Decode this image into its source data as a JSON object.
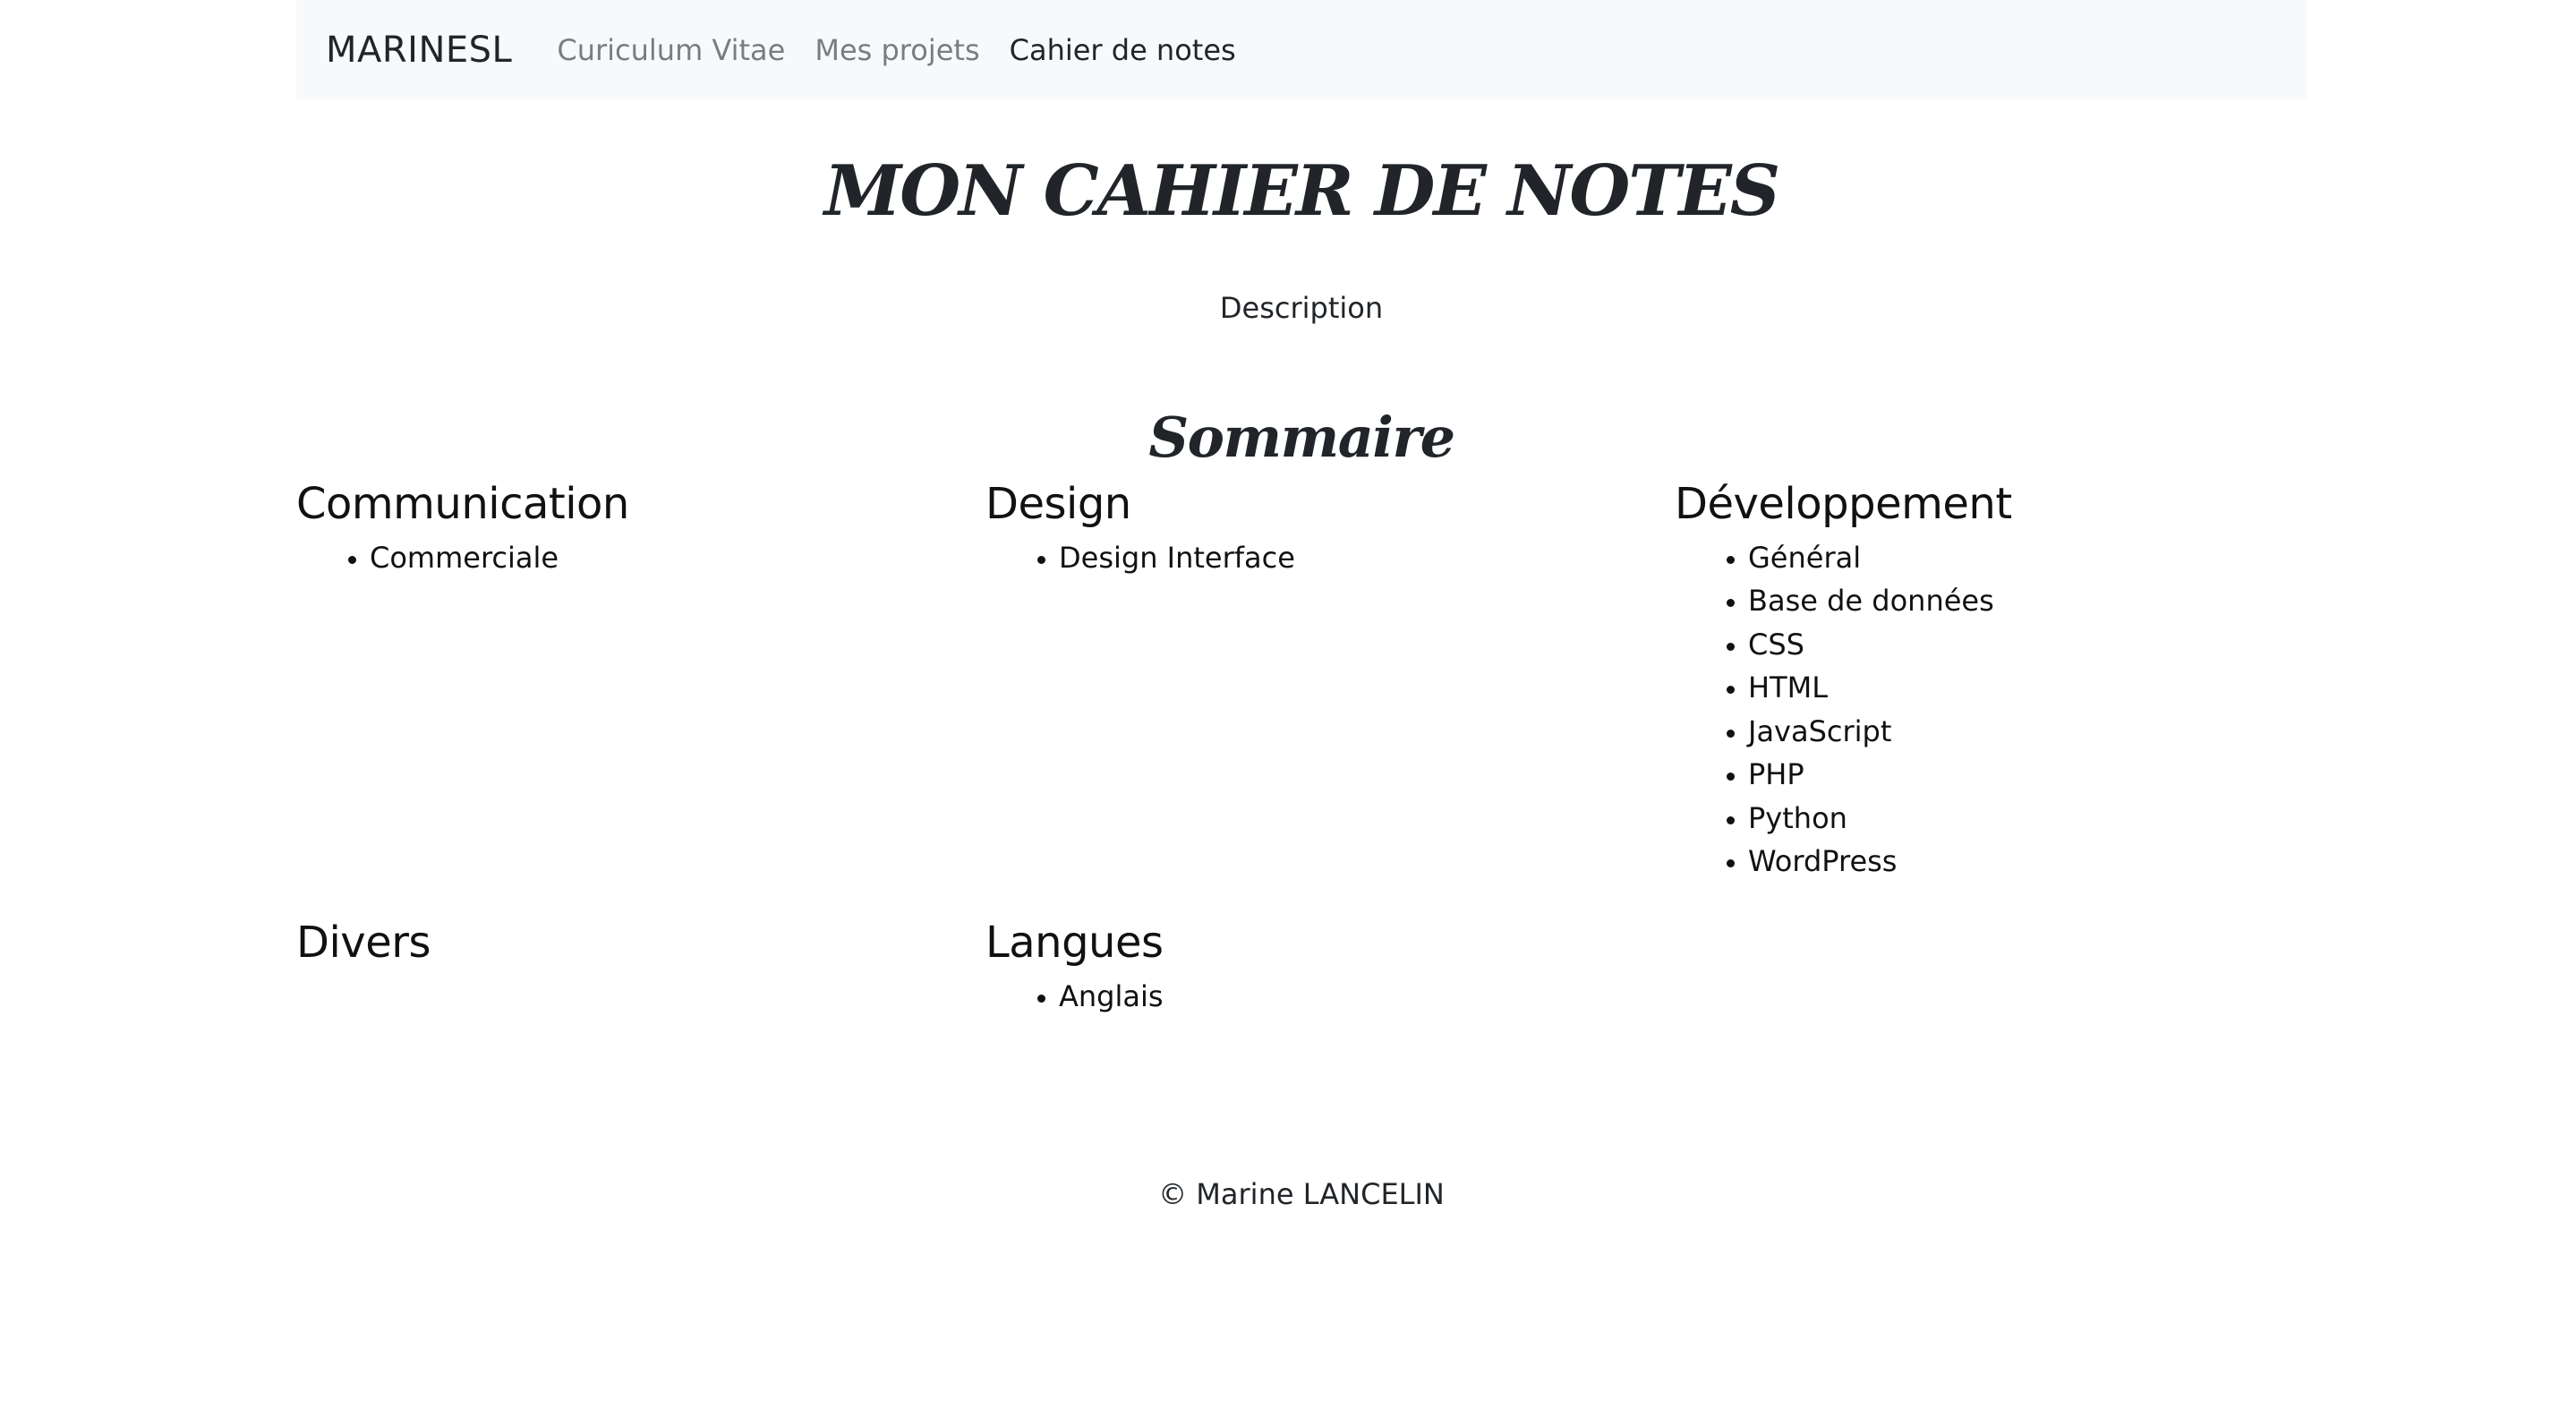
{
  "navbar": {
    "brand": "MARINESL",
    "links": [
      {
        "label": "Curiculum Vitae",
        "active": false
      },
      {
        "label": "Mes projets",
        "active": false
      },
      {
        "label": "Cahier de notes",
        "active": true
      }
    ]
  },
  "main": {
    "title": "MON CAHIER DE NOTES",
    "description": "Description",
    "summary_title": "Sommaire",
    "sections": [
      {
        "title": "Communication",
        "items": [
          "Commerciale"
        ]
      },
      {
        "title": "Design",
        "items": [
          "Design Interface"
        ]
      },
      {
        "title": "Développement",
        "items": [
          "Général",
          "Base de données",
          "CSS",
          "HTML",
          "JavaScript",
          "PHP",
          "Python",
          "WordPress"
        ]
      },
      {
        "title": "Divers",
        "items": []
      },
      {
        "title": "Langues",
        "items": [
          "Anglais"
        ]
      }
    ]
  },
  "footer": {
    "copyright": "© Marine LANCELIN"
  }
}
